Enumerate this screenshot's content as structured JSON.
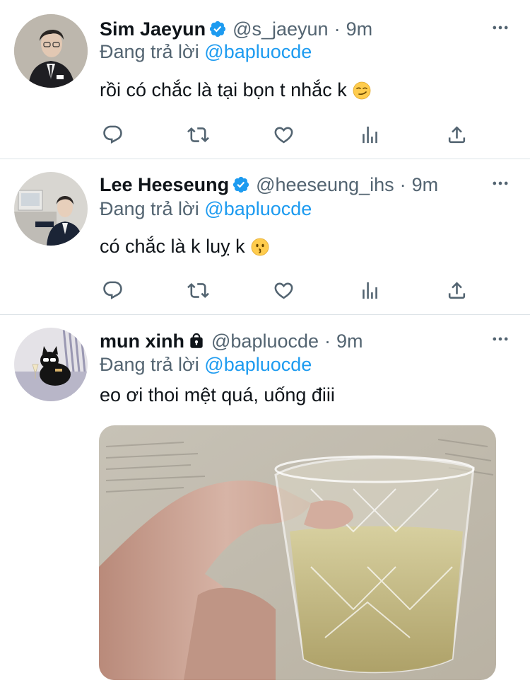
{
  "tweets": [
    {
      "name": "Sim Jaeyun",
      "verified": true,
      "handle": "@s_jaeyun",
      "time": "9m",
      "reply_prefix": "Đang trả lời",
      "reply_to": "@bapluocde",
      "text": "rồi có chắc là tại bọn t nhắc k",
      "emoji": "smirking-face"
    },
    {
      "name": "Lee Heeseung",
      "verified": true,
      "handle": "@heeseung_ihs",
      "time": "9m",
      "reply_prefix": "Đang trả lời",
      "reply_to": "@bapluocde",
      "text": "có chắc là k luỵ k",
      "emoji": "kissing-face"
    },
    {
      "name": "mun xinh",
      "verified": false,
      "protected": true,
      "handle": "@bapluocde",
      "time": "9m",
      "reply_prefix": "Đang trả lời",
      "reply_to": "@bapluocde",
      "text": "eo ơi thoi mệt quá, uống điii",
      "media": "photo-glass-of-drink"
    }
  ],
  "separator": "·",
  "colors": {
    "text": "#0f1419",
    "secondary": "#536471",
    "accent": "#1d9bf0",
    "divider": "#dde3e7"
  },
  "icons": [
    "reply-icon",
    "retweet-icon",
    "like-icon",
    "stats-icon",
    "share-icon",
    "more-icon",
    "verified-icon",
    "lock-icon"
  ]
}
